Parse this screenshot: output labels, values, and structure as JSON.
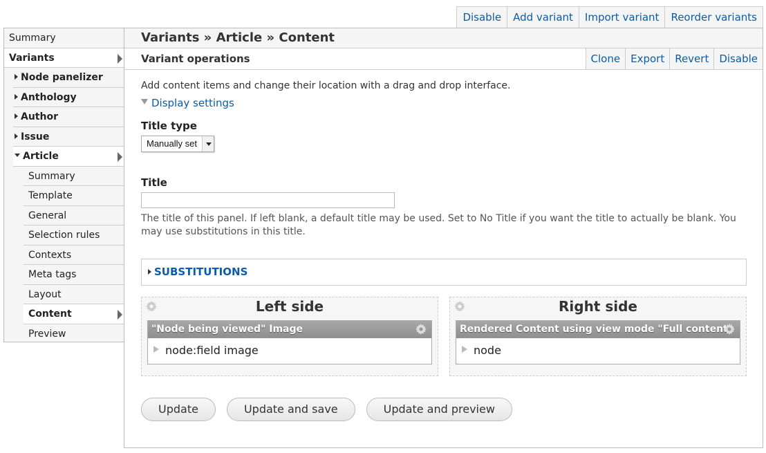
{
  "top_ops": [
    "Disable",
    "Add variant",
    "Import variant",
    "Reorder variants"
  ],
  "sidebar": {
    "summary": "Summary",
    "variants": "Variants",
    "groups": [
      "Node panelizer",
      "Anthology",
      "Author",
      "Issue"
    ],
    "article": "Article",
    "article_items": [
      "Summary",
      "Template",
      "General",
      "Selection rules",
      "Contexts",
      "Meta tags",
      "Layout",
      "Content",
      "Preview"
    ],
    "current_item": "Content"
  },
  "main": {
    "breadcrumb": "Variants » Article » Content",
    "ops_title": "Variant operations",
    "ops": [
      "Clone",
      "Export",
      "Revert",
      "Disable"
    ],
    "intro": "Add content items and change their location with a drag and drop interface.",
    "display_settings": "Display settings",
    "title_type_label": "Title type",
    "title_type_value": "Manually set",
    "title_label": "Title",
    "title_value": "",
    "title_description": "The title of this panel. If left blank, a default title may be used. Set to No Title if you want the title to actually be blank. You may use substitutions in this title.",
    "substitutions": "SUBSTITUTIONS",
    "regions": [
      {
        "title": "Left side",
        "pane_title": "\"Node being viewed\" Image",
        "pane_body": "node:field image"
      },
      {
        "title": "Right side",
        "pane_title": "Rendered Content using view mode \"Full content\"",
        "pane_body": "node"
      }
    ],
    "buttons": [
      "Update",
      "Update and save",
      "Update and preview"
    ]
  }
}
